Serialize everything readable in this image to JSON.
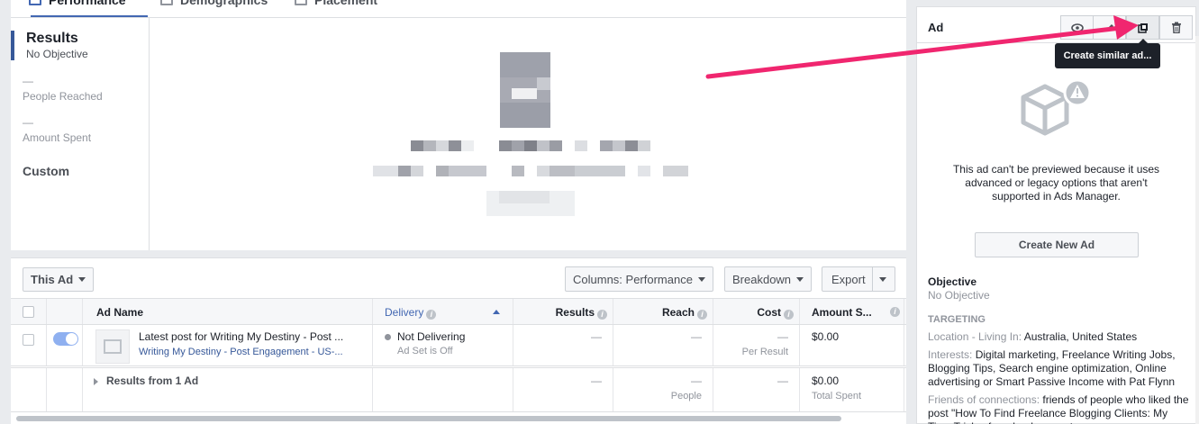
{
  "tabs": [
    {
      "label": "Performance",
      "icon": "bar-chart-icon",
      "active": true
    },
    {
      "label": "Demographics",
      "icon": "people-icon",
      "active": false
    },
    {
      "label": "Placement",
      "icon": "placement-icon",
      "active": false
    }
  ],
  "metrics": {
    "results_title": "Results",
    "results_sub": "No Objective",
    "reach_dash": "—",
    "reach_label": "People Reached",
    "spent_dash": "—",
    "spent_label": "Amount Spent",
    "custom_label": "Custom"
  },
  "toolbar": {
    "scope_label": "This Ad",
    "columns_label": "Columns: Performance",
    "breakdown_label": "Breakdown",
    "export_label": "Export"
  },
  "table": {
    "headers": {
      "ad_name": "Ad Name",
      "delivery": "Delivery",
      "results": "Results",
      "reach": "Reach",
      "cost": "Cost",
      "amount": "Amount S..."
    },
    "row": {
      "name": "Latest post for Writing My Destiny - Post ...",
      "campaign": "Writing My Destiny - Post Engagement - US-...",
      "delivery": "Not Delivering",
      "delivery_sub": "Ad Set is Off",
      "results": "—",
      "reach": "—",
      "cost": "—",
      "cost_sub": "Per Result",
      "amount": "$0.00"
    },
    "summary": {
      "label": "Results from 1 Ad",
      "results": "—",
      "reach": "—",
      "reach_sub": "People",
      "cost": "—",
      "amount": "$0.00",
      "amount_sub": "Total Spent"
    }
  },
  "right_panel": {
    "title": "Ad",
    "tooltip": "Create similar ad...",
    "preview_message": "This ad can't be previewed because it uses advanced or legacy options that aren't supported in Ads Manager.",
    "create_button": "Create New Ad",
    "objective_label": "Objective",
    "objective_value": "No Objective",
    "targeting_label": "TARGETING",
    "location_label": "Location - Living In:",
    "location_value": "Australia, United States",
    "interests_label": "Interests:",
    "interests_value": "Digital marketing, Freelance Writing Jobs, Blogging Tips, Search engine optimization, Online advertising or Smart Passive Income with Pat Flynn",
    "friends_label": "Friends of connections:",
    "friends_value": "friends of people who liked the post \"How To Find Freelance Blogging Clients: My Tips, Tricks, for a lead generator..."
  },
  "colors": {
    "accent": "#4267b2",
    "arrow": "#f0266f",
    "tooltip_bg": "#1d2129"
  }
}
